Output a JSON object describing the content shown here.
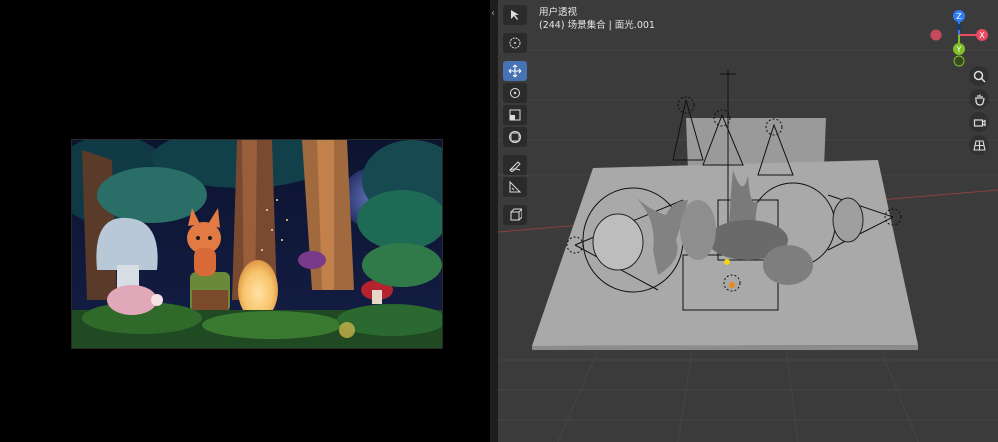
{
  "viewport": {
    "view_name": "用户透视",
    "collection_info": "(244) 场景集合 | 面光.001"
  },
  "gizmo": {
    "z_label": "Z",
    "x_label": "X",
    "y_label": "Y",
    "colors": {
      "z": "#2f7cf6",
      "x": "#e84a5f",
      "y": "#7fbf2a",
      "neg": "#c64a5a"
    }
  },
  "toolbar": {
    "tools": [
      "select-box",
      "cursor",
      "move",
      "rotate",
      "scale",
      "transform",
      "annotate",
      "measure",
      "add-cube"
    ],
    "active_tool": "move"
  },
  "colors": {
    "active_tool": "#4772b3",
    "viewport_bg": "#3b3b3b",
    "floor": "#a9a9a9"
  }
}
